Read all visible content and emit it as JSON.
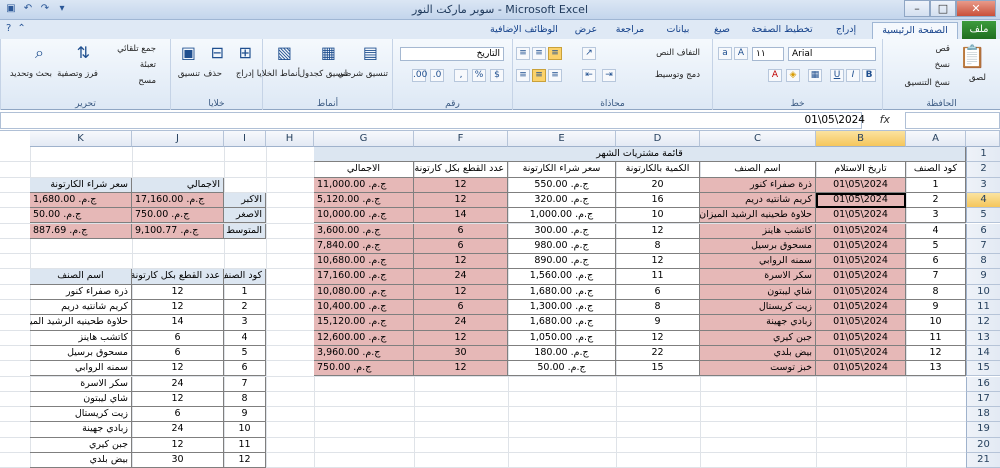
{
  "window": {
    "title": "سوبر ماركت النور  -  Microsoft Excel"
  },
  "ribbon_tabs": [
    "ملف",
    "الصفحة الرئيسية",
    "إدراج",
    "تخطيط الصفحة",
    "صيغ",
    "بيانات",
    "مراجعة",
    "عرض",
    "الوظائف الإضافية"
  ],
  "ribbon": {
    "clipboard": {
      "group": "الحافظة",
      "paste": "لصق",
      "cut": "قص",
      "copy": "نسخ",
      "format_painter": "نسخ التنسيق"
    },
    "font": {
      "group": "خط",
      "name": "Arial",
      "size": "١١"
    },
    "alignment": {
      "group": "محاذاة",
      "wrap": "التفاف النص",
      "merge": "دمج وتوسيط"
    },
    "number": {
      "group": "رقم",
      "format": "التاريخ"
    },
    "styles": {
      "group": "أنماط",
      "conditional": "تنسيق شرطي",
      "as_table": "تنسيق كجدول",
      "cell_styles": "أنماط الخلايا"
    },
    "cells": {
      "group": "خلايا",
      "insert": "إدراج",
      "delete": "حذف",
      "format": "تنسيق"
    },
    "editing": {
      "group": "تحرير",
      "autosum": "جمع تلقائي",
      "fill": "تعبئة",
      "clear": "مسح",
      "sort": "فرز وتصفية",
      "find": "بحث وتحديد"
    }
  },
  "formula_bar": {
    "name_box": "",
    "fx": "fx",
    "value": "01\\05\\2024"
  },
  "columns": [
    "A",
    "B",
    "C",
    "D",
    "E",
    "F",
    "G",
    "H",
    "I",
    "J",
    "K"
  ],
  "selected_column": "B",
  "rows": [
    "1",
    "2",
    "3",
    "4",
    "5",
    "6",
    "7",
    "8",
    "9",
    "10",
    "11",
    "12",
    "13",
    "14",
    "15",
    "16",
    "17",
    "18",
    "19",
    "20",
    "21"
  ],
  "selected_row": "4",
  "main_table": {
    "title": "قائمة مشتريات الشهر",
    "headers": [
      "كود الصنف",
      "تاريخ الاستلام",
      "اسم الصنف",
      "الكمية بالكارتونة",
      "سعر شراء الكارتونة",
      "عدد القطع بكل كارتونة",
      "الاجمالي"
    ],
    "rows": [
      [
        "1",
        "01\\05\\2024",
        "ذرة صفراء كنور",
        "20",
        "ج.م. 550.00",
        "12",
        "ج.م. 11,000.00"
      ],
      [
        "2",
        "01\\05\\2024",
        "كريم شانتيه دريم",
        "16",
        "ج.م. 320.00",
        "12",
        "ج.م. 5,120.00"
      ],
      [
        "3",
        "01\\05\\2024",
        "حلاوة طحينيه الرشيد الميزان",
        "10",
        "ج.م. 1,000.00",
        "14",
        "ج.م. 10,000.00"
      ],
      [
        "4",
        "01\\05\\2024",
        "كاتشب هاينز",
        "12",
        "ج.م. 300.00",
        "6",
        "ج.م. 3,600.00"
      ],
      [
        "5",
        "01\\05\\2024",
        "مسحوق برسيل",
        "8",
        "ج.م. 980.00",
        "6",
        "ج.م. 7,840.00"
      ],
      [
        "6",
        "01\\05\\2024",
        "سمنه الروابي",
        "12",
        "ج.م. 890.00",
        "12",
        "ج.م. 10,680.00"
      ],
      [
        "7",
        "01\\05\\2024",
        "سكر الاسرة",
        "11",
        "ج.م. 1,560.00",
        "24",
        "ج.م. 17,160.00"
      ],
      [
        "8",
        "01\\05\\2024",
        "شاي ليبتون",
        "6",
        "ج.م. 1,680.00",
        "12",
        "ج.م. 10,080.00"
      ],
      [
        "9",
        "01\\05\\2024",
        "زيت كريستال",
        "8",
        "ج.م. 1,300.00",
        "6",
        "ج.م. 10,400.00"
      ],
      [
        "10",
        "01\\05\\2024",
        "زبادي جهينة",
        "9",
        "ج.م. 1,680.00",
        "24",
        "ج.م. 15,120.00"
      ],
      [
        "11",
        "01\\05\\2024",
        "جبن كيري",
        "12",
        "ج.م. 1,050.00",
        "12",
        "ج.م. 12,600.00"
      ],
      [
        "12",
        "01\\05\\2024",
        "بيض بلدي",
        "22",
        "ج.م. 180.00",
        "30",
        "ج.م. 3,960.00"
      ],
      [
        "13",
        "01\\05\\2024",
        "خبز توست",
        "15",
        "ج.م. 50.00",
        "12",
        "ج.م. 750.00"
      ]
    ]
  },
  "stats_table": {
    "headers": [
      "الاجمالي",
      "سعر شراء الكارتونة"
    ],
    "rows": [
      [
        "الاكبر",
        "ج.م. 17,160.00",
        "ج.م. 1,680.00"
      ],
      [
        "الاصغر",
        "ج.م. 750.00",
        "ج.م. 50.00"
      ],
      [
        "المتوسط",
        "ج.م. 9,100.77",
        "ج.م. 887.69"
      ]
    ]
  },
  "lookup_table": {
    "headers": [
      "كود الصنف",
      "عدد القطع بكل كارتونة",
      "اسم الصنف"
    ],
    "rows": [
      [
        "1",
        "12",
        "ذرة صفراء كنور"
      ],
      [
        "2",
        "12",
        "كريم شانتيه دريم"
      ],
      [
        "3",
        "14",
        "حلاوة طحينيه الرشيد الميزان"
      ],
      [
        "4",
        "6",
        "كاتشب هاينز"
      ],
      [
        "5",
        "6",
        "مسحوق برسيل"
      ],
      [
        "6",
        "12",
        "سمنه الروابي"
      ],
      [
        "7",
        "24",
        "سكر الاسرة"
      ],
      [
        "8",
        "12",
        "شاي ليبتون"
      ],
      [
        "9",
        "6",
        "زيت كريستال"
      ],
      [
        "10",
        "24",
        "زبادي جهينة"
      ],
      [
        "11",
        "12",
        "جبن كيري"
      ],
      [
        "12",
        "30",
        "بيض بلدي"
      ]
    ]
  }
}
